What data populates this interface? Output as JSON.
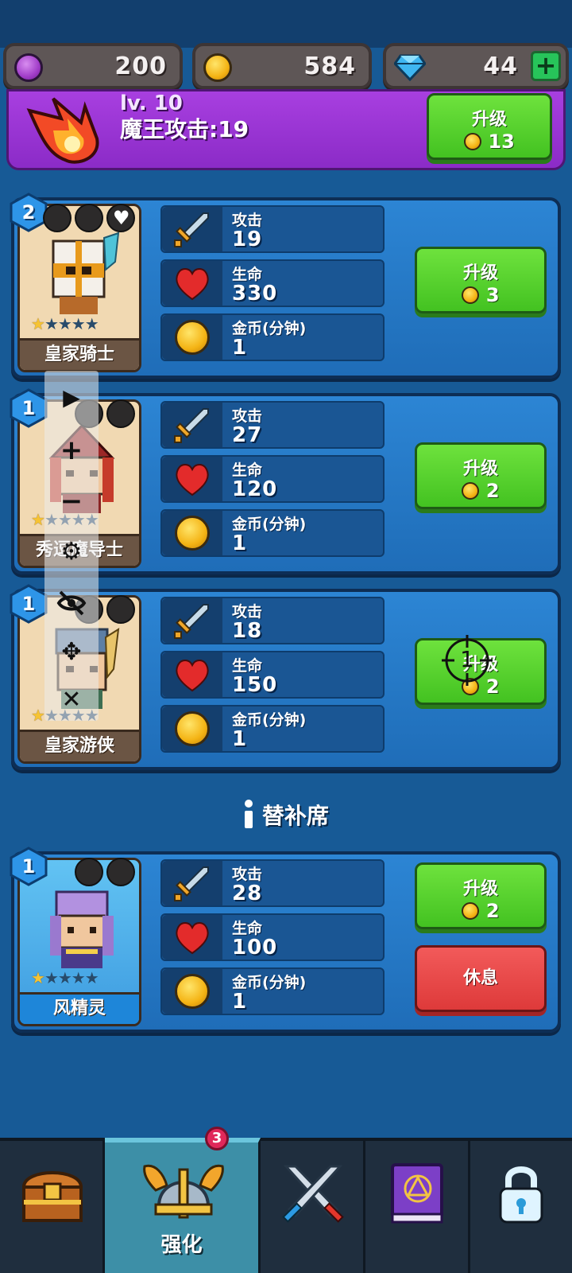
{
  "currency": {
    "purple_value": "200",
    "gold_value": "584",
    "gem_value": "44",
    "plus_label": "+"
  },
  "boss": {
    "level_text": "lv. 10",
    "attack_text": "魔王攻击:19",
    "upgrade_label": "升级",
    "upgrade_cost": "13"
  },
  "stat_labels": {
    "attack": "攻击",
    "hp": "生命",
    "gold": "金币(分钟)"
  },
  "heroes": [
    {
      "name": "皇家骑士",
      "level": "2",
      "stars": 1,
      "attack": "19",
      "hp": "330",
      "gold": "1",
      "upgrade_label": "升级",
      "upgrade_cost": "3"
    },
    {
      "name": "秀逗魔导士",
      "level": "1",
      "stars": 1,
      "attack": "27",
      "hp": "120",
      "gold": "1",
      "upgrade_label": "升级",
      "upgrade_cost": "2"
    },
    {
      "name": "皇家游侠",
      "level": "1",
      "stars": 1,
      "attack": "18",
      "hp": "150",
      "gold": "1",
      "upgrade_label": "升级",
      "upgrade_cost": "2"
    }
  ],
  "bench": {
    "header": "替补席",
    "hero": {
      "name": "风精灵",
      "level": "1",
      "stars": 1,
      "attack": "28",
      "hp": "100",
      "gold": "1",
      "upgrade_label": "升级",
      "upgrade_cost": "2",
      "rest_label": "休息"
    }
  },
  "overlay": {
    "play": "▶",
    "zoom_in": "+",
    "zoom_out": "−",
    "settings": "⚙",
    "move": "✥",
    "close": "✕"
  },
  "crosshair_label": "1",
  "nav": {
    "upgrade_label": "强化",
    "notification_count": "3"
  },
  "colors": {
    "background": "#175a96",
    "boss_panel": "#9b35d6",
    "upgrade_green": "#55cf2b",
    "rest_red": "#e54848",
    "nav_active": "#3d8fa7"
  }
}
